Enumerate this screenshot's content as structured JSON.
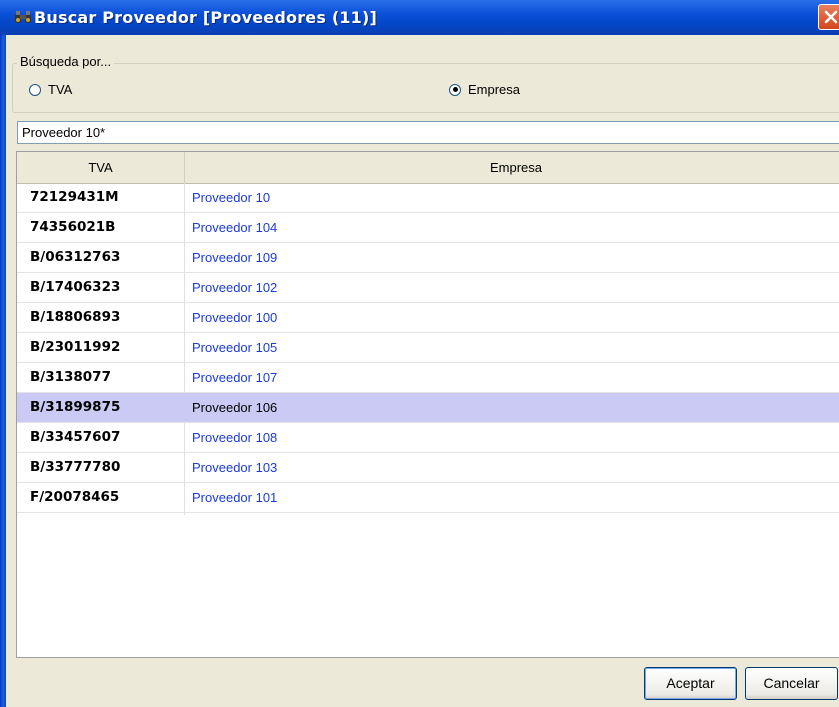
{
  "window": {
    "title": "Buscar Proveedor [Proveedores (11)]"
  },
  "search_by": {
    "label": "Búsqueda por...",
    "options": [
      {
        "label": "TVA",
        "selected": false
      },
      {
        "label": "Empresa",
        "selected": true
      }
    ]
  },
  "search": {
    "value": "Proveedor 10*"
  },
  "table": {
    "columns": [
      "TVA",
      "Empresa"
    ],
    "rows": [
      {
        "tva": "72129431M",
        "empresa": "Proveedor 10"
      },
      {
        "tva": "74356021B",
        "empresa": "Proveedor 104"
      },
      {
        "tva": "B/06312763",
        "empresa": "Proveedor 109"
      },
      {
        "tva": "B/17406323",
        "empresa": "Proveedor 102"
      },
      {
        "tva": "B/18806893",
        "empresa": "Proveedor 100"
      },
      {
        "tva": "B/23011992",
        "empresa": "Proveedor 105"
      },
      {
        "tva": "B/3138077",
        "empresa": "Proveedor 107"
      },
      {
        "tva": "B/31899875",
        "empresa": "Proveedor 106",
        "selected": true
      },
      {
        "tva": "B/33457607",
        "empresa": "Proveedor 108"
      },
      {
        "tva": "B/33777780",
        "empresa": "Proveedor 103"
      },
      {
        "tva": "F/20078465",
        "empresa": "Proveedor 101"
      }
    ]
  },
  "buttons": {
    "accept": "Aceptar",
    "cancel": "Cancelar"
  },
  "colors": {
    "titlebar": "#0a4fd8",
    "link_text": "#1a3bd8",
    "selected_row": "#cacaf5",
    "dialog_bg": "#ece9d8"
  },
  "icons": {
    "title": "binoculars-icon",
    "close": "close-icon"
  }
}
